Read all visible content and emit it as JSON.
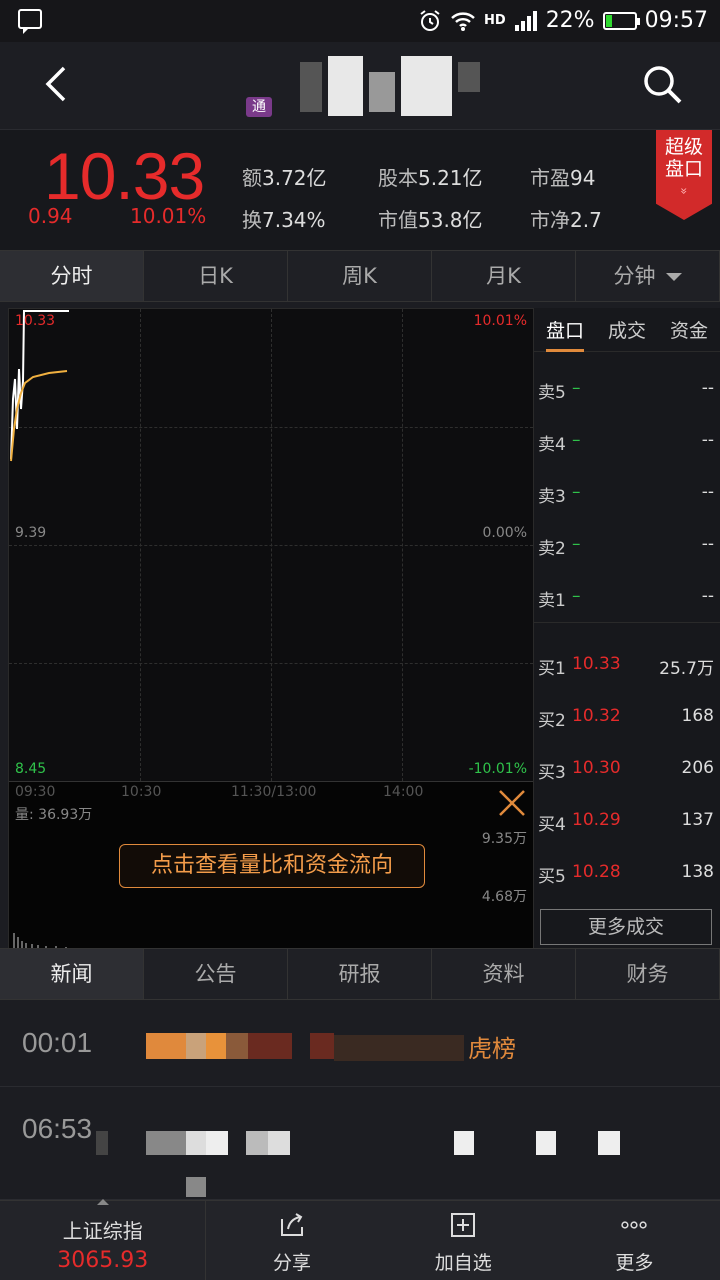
{
  "status_bar": {
    "hd": "HD",
    "battery": "22%",
    "battery_level": 0.22,
    "time": "09:57"
  },
  "nav": {
    "badge": "通"
  },
  "quote": {
    "price": "10.33",
    "change": "0.94",
    "change_pct": "10.01%",
    "amount_label": "额",
    "amount": "3.72亿",
    "turnover_label": "换",
    "turnover": "7.34%",
    "shares_label": "股本",
    "shares": "5.21亿",
    "mktcap_label": "市值",
    "mktcap": "53.8亿",
    "pe_label": "市盈",
    "pe": "94",
    "pb_label": "市净",
    "pb": "2.7",
    "super_label_1": "超级",
    "super_label_2": "盘口",
    "super_chevron": "»"
  },
  "period_tabs": [
    "分时",
    "日K",
    "周K",
    "月K",
    "分钟"
  ],
  "chart": {
    "price_high": "10.33",
    "price_mid": "9.39",
    "price_low": "8.45",
    "pct_high": "10.01%",
    "pct_mid": "0.00%",
    "pct_low": "-10.01%",
    "times": [
      "09:30",
      "10:30",
      "11:30/13:00",
      "14:00"
    ],
    "volume_label": "量: 36.93万",
    "vol_high": "9.35万",
    "vol_mid": "4.68万",
    "hint": "点击查看量比和资金流向"
  },
  "order_book": {
    "tabs": [
      "盘口",
      "成交",
      "资金"
    ],
    "asks": [
      {
        "label": "卖5",
        "price": "–",
        "qty": "--"
      },
      {
        "label": "卖4",
        "price": "–",
        "qty": "--"
      },
      {
        "label": "卖3",
        "price": "–",
        "qty": "--"
      },
      {
        "label": "卖2",
        "price": "–",
        "qty": "--"
      },
      {
        "label": "卖1",
        "price": "–",
        "qty": "--"
      }
    ],
    "bids": [
      {
        "label": "买1",
        "price": "10.33",
        "qty": "25.7万"
      },
      {
        "label": "买2",
        "price": "10.32",
        "qty": "168"
      },
      {
        "label": "买3",
        "price": "10.30",
        "qty": "206"
      },
      {
        "label": "买4",
        "price": "10.29",
        "qty": "137"
      },
      {
        "label": "买5",
        "price": "10.28",
        "qty": "138"
      }
    ],
    "more": "更多成交"
  },
  "news_tabs": [
    "新闻",
    "公告",
    "研报",
    "资料",
    "财务"
  ],
  "news": [
    {
      "time": "00:01",
      "title": "虎榜"
    },
    {
      "time": "06:53",
      "title": ""
    }
  ],
  "bottom_bar": {
    "index_name": "上证综指",
    "index_value": "3065.93",
    "share": "分享",
    "add": "加自选",
    "more": "更多"
  },
  "colors": {
    "up": "#e62b2b",
    "down": "#2fc24a",
    "accent": "#e08a3c",
    "price_line": "#ffffff",
    "avg_line": "#f0b040"
  }
}
